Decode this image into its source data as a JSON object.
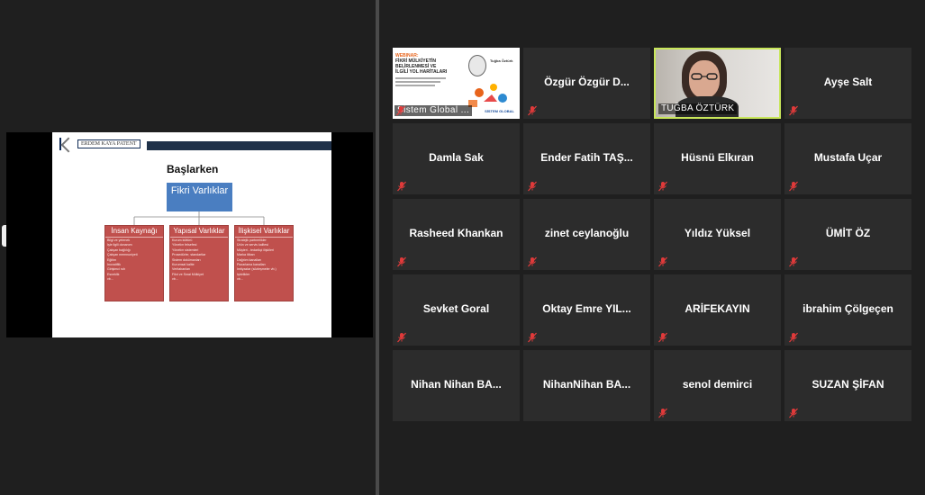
{
  "shared_screen": {
    "logo_text": "ERDEM KAYA PATENT",
    "slide_title": "Başlarken",
    "root_box": "Fikri Varlıklar",
    "branches": [
      {
        "title": "İnsan Kaynağı",
        "items": [
          "Bilgi ve yetenek",
          "İşle ilgili donanım",
          "Çalışan bağlılığı",
          "Çalışan memnuniyeti",
          "Eğitim",
          "İnovatiflik",
          "Girişimci ruh",
          "Esneklik",
          "vb..."
        ]
      },
      {
        "title": "Yapısal Varlıklar",
        "items": [
          "Kurum kültürü",
          "Yönetim felsefesi",
          "Yönetim sistemleri",
          "Prosedürler, standartlar",
          "Sistem dokümanları",
          "Kurumsal kalite",
          "Veritabanları",
          "Fikri ve Sınai Mülkiyet",
          "vb..."
        ]
      },
      {
        "title": "İlişkisel Varlıklar",
        "items": [
          "Stratejik partnerlikler",
          "Ürün ve servis kalitesi",
          "Müşteri - tedarikçi ilişkileri",
          "Marka itibarı",
          "Dağıtım kanalları",
          "Pazarlama kanalları",
          "İmtiyazlar (sözleşmeler vb.)",
          "İşbirlikler",
          "vb..."
        ]
      }
    ]
  },
  "poster": {
    "heading_orange": "WEBINAR:",
    "heading_lines": [
      "FİKRİ MÜLKİYETİN",
      "BELİRLENMESİ VE",
      "İLGİLİ YOL HARİTALARI"
    ],
    "speaker": "Tuğba Öztürk",
    "brand": "SİSTEM GLOBAL"
  },
  "participants": [
    {
      "name": "Sistem Global ...",
      "kind": "poster",
      "muted": true
    },
    {
      "name": "Özgür Özgür D...",
      "muted": true
    },
    {
      "name": "TUĞBA ÖZTÜRK",
      "kind": "video",
      "muted": false
    },
    {
      "name": "Ayşe Salt",
      "muted": true
    },
    {
      "name": "Damla Sak",
      "muted": true
    },
    {
      "name": "Ender Fatih TAŞ...",
      "muted": true
    },
    {
      "name": "Hüsnü Elkıran",
      "muted": true
    },
    {
      "name": "Mustafa Uçar",
      "muted": true
    },
    {
      "name": "Rasheed Khankan",
      "muted": true
    },
    {
      "name": "zinet ceylanoğlu",
      "muted": true
    },
    {
      "name": "Yıldız Yüksel",
      "muted": true
    },
    {
      "name": "ÜMİT ÖZ",
      "muted": true
    },
    {
      "name": "Sevket Goral",
      "muted": true
    },
    {
      "name": "Oktay Emre YIL...",
      "muted": true
    },
    {
      "name": "ARİFEKAYIN",
      "muted": true
    },
    {
      "name": "ibrahim Çölgeçen",
      "muted": true
    },
    {
      "name": "Nihan Nihan BA...",
      "muted": false
    },
    {
      "name": "NihanNihan BA...",
      "muted": false
    },
    {
      "name": "senol demirci",
      "muted": true
    },
    {
      "name": "SUZAN ŞİFAN",
      "muted": true
    }
  ],
  "icons": {
    "mic_muted": "mic-off-icon",
    "nav_left": "chevron-left-icon"
  },
  "colors": {
    "active_speaker_border": "#c8e65a",
    "mic_muted": "#e03a3a",
    "tile_bg": "#2c2c2c",
    "branch_red": "#c0504d",
    "root_blue": "#4a7ec1"
  }
}
